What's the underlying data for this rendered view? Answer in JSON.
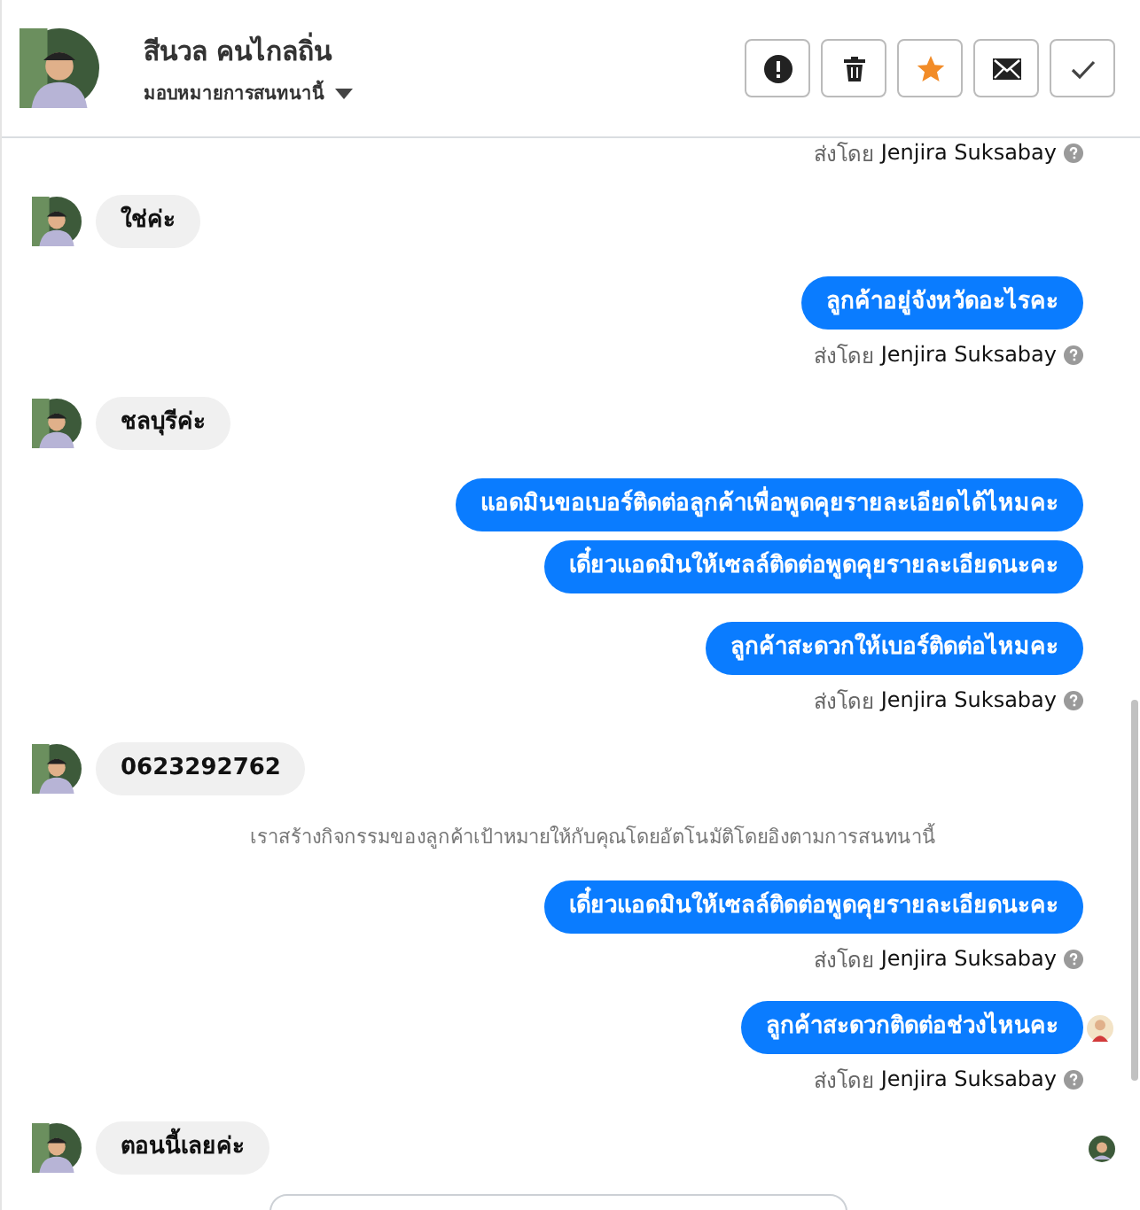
{
  "header": {
    "name": "สีนวล คนไกลถิ่น",
    "assign_label": "มอบหมายการสนทนานี้",
    "buttons": [
      {
        "kind": "alert"
      },
      {
        "kind": "trash"
      },
      {
        "kind": "star"
      },
      {
        "kind": "mail"
      },
      {
        "kind": "check"
      }
    ]
  },
  "items": [
    {
      "kind": "sent-by",
      "label": "ส่งโดย",
      "name": "Jenjira Suksabay"
    },
    {
      "kind": "incoming",
      "messages": [
        {
          "text": "ใช่ค่ะ",
          "seen": false
        }
      ]
    },
    {
      "kind": "outgoing",
      "messages": [
        {
          "text": "ลูกค้าอยู่จังหวัดอะไรคะ",
          "seen": false
        }
      ]
    },
    {
      "kind": "sent-by",
      "label": "ส่งโดย",
      "name": "Jenjira Suksabay"
    },
    {
      "kind": "incoming",
      "messages": [
        {
          "text": "ชลบุรีค่ะ",
          "seen": false
        }
      ]
    },
    {
      "kind": "outgoing",
      "messages": [
        {
          "text": "แอดมินขอเบอร์ติดต่อลูกค้าเพื่อพูดคุยรายละเอียดได้ไหมคะ",
          "seen": false
        },
        {
          "text": "เดี๋ยวแอดมินให้เซลล์ติดต่อพูดคุยรายละเอียดนะคะ",
          "seen": false
        }
      ]
    },
    {
      "kind": "outgoing",
      "messages": [
        {
          "text": "ลูกค้าสะดวกให้เบอร์ติดต่อไหมคะ",
          "seen": false
        }
      ]
    },
    {
      "kind": "sent-by",
      "label": "ส่งโดย",
      "name": "Jenjira Suksabay"
    },
    {
      "kind": "incoming",
      "messages": [
        {
          "text": "0623292762",
          "seen": false
        }
      ]
    },
    {
      "kind": "system",
      "text": "เราสร้างกิจกรรมของลูกค้าเป้าหมายให้กับคุณโดยอัตโนมัติโดยอิงตามการสนทนานี้"
    },
    {
      "kind": "outgoing",
      "messages": [
        {
          "text": "เดี๋ยวแอดมินให้เซลล์ติดต่อพูดคุยรายละเอียดนะคะ",
          "seen": false
        }
      ]
    },
    {
      "kind": "sent-by",
      "label": "ส่งโดย",
      "name": "Jenjira Suksabay"
    },
    {
      "kind": "outgoing",
      "messages": [
        {
          "text": "ลูกค้าสะดวกติดต่อช่วงไหนคะ",
          "seen": true
        }
      ]
    },
    {
      "kind": "sent-by",
      "label": "ส่งโดย",
      "name": "Jenjira Suksabay"
    },
    {
      "kind": "incoming",
      "messages": [
        {
          "text": "ตอนนี้เลยค่ะ",
          "seen": true
        }
      ]
    }
  ]
}
